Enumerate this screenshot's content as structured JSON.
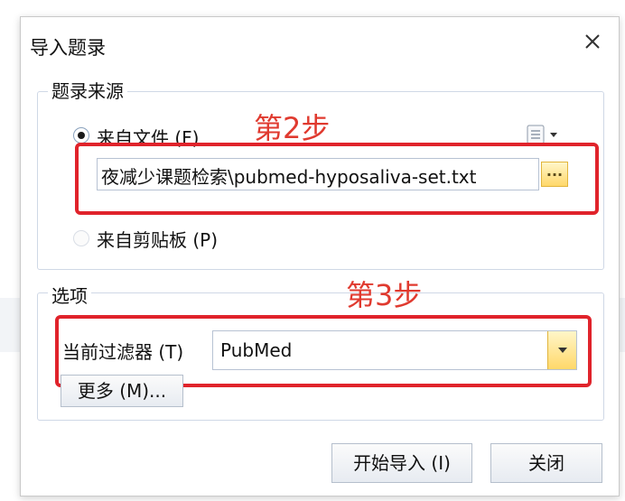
{
  "dialog": {
    "title": "导入题录"
  },
  "source_group": {
    "label": "题录来源",
    "from_file_label": "来自文件 (F)",
    "from_file_selected": true,
    "file_path": "夜减少课题检索\\pubmed-hyposaliva-set.txt",
    "browse_label": "...",
    "from_clipboard_label": "来自剪贴板 (P)",
    "from_clipboard_selected": false,
    "step_annotation": "第2步"
  },
  "options_group": {
    "label": "选项",
    "filter_label": "当前过滤器 (T)",
    "filter_value": "PubMed",
    "more_button_label": "更多 (M)...",
    "step_annotation": "第3步"
  },
  "footer": {
    "start_import_label": "开始导入 (I)",
    "close_label": "关闭"
  },
  "colors": {
    "annotation_red": "#e0232b",
    "accent_yellow": "#ffd86a"
  }
}
